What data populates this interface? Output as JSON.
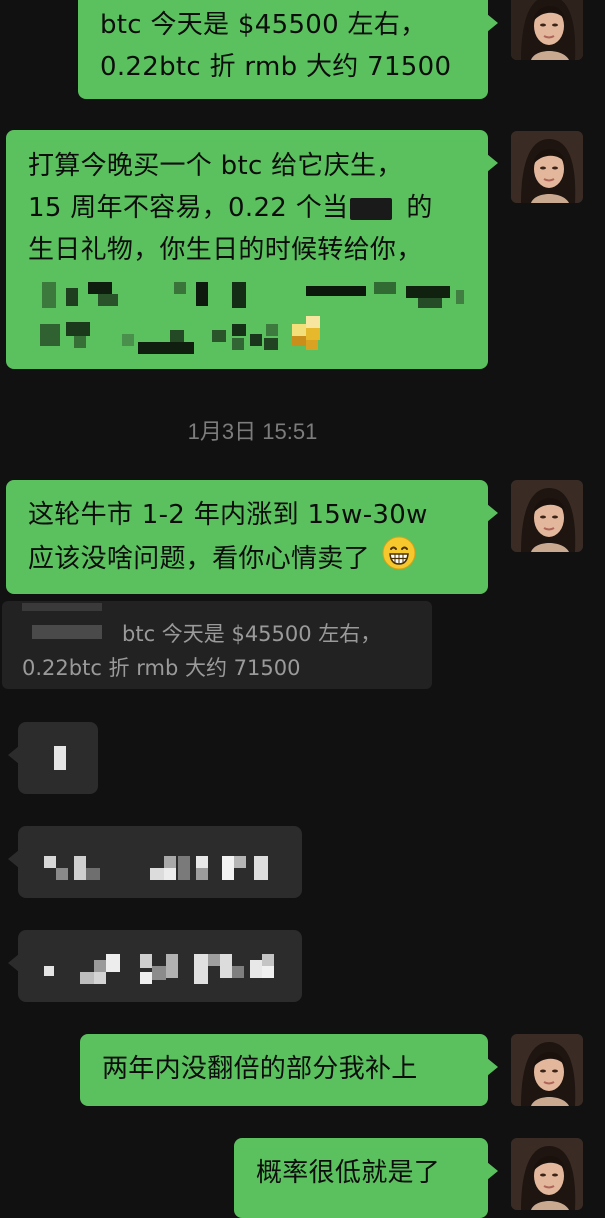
{
  "messages": {
    "m1": {
      "line1": "btc 今天是 $45500 左右，",
      "line2": "0.22btc 折 rmb 大约 71500"
    },
    "m2": {
      "line1": "打算今晚买一个 btc 给它庆生，",
      "line2": "15 周年不容易，0.22 个当",
      "line2_end": "的",
      "line3": "生日礼物，你生日的时候转给你，"
    },
    "timestamp": "1月3日 15:51",
    "m3": {
      "line1": "这轮牛市 1-2 年内涨到 15w-30w",
      "line2": "应该没啥问题，看你心情卖了",
      "emoji": "😁"
    },
    "quote": {
      "line1": "btc 今天是 $45500 左右，",
      "line2": "0.22btc 折 rmb 大约 71500"
    },
    "m4": {
      "text": "两年内没翻倍的部分我补上"
    },
    "m5": {
      "text": "概率很低就是了"
    }
  },
  "colors": {
    "background": "#111111",
    "outgoing_bubble": "#5ac15e",
    "incoming_bubble": "#2c2c2c",
    "quote_bg": "#222222",
    "timestamp": "#7c7c7c"
  },
  "icons": [
    "avatar-image",
    "grin-emoji"
  ]
}
